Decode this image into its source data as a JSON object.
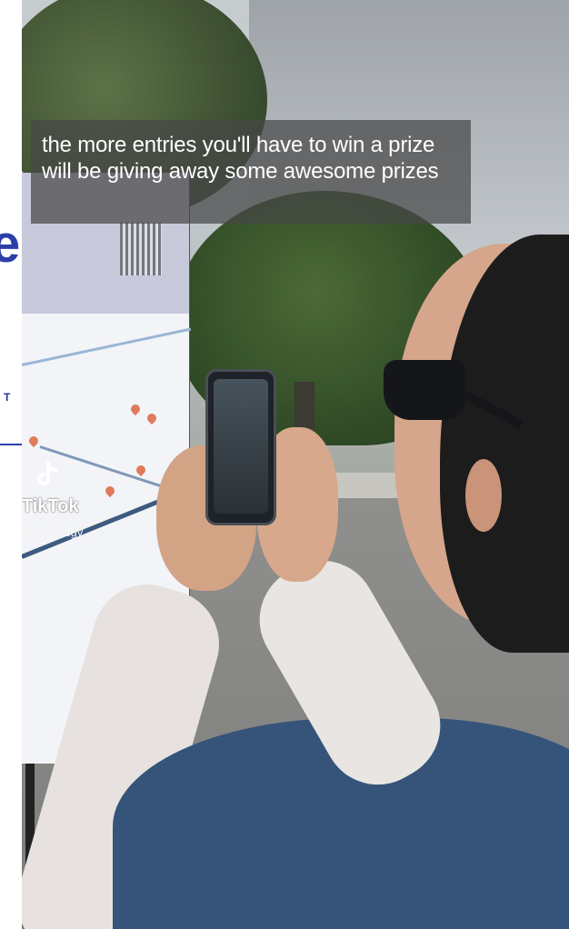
{
  "page_edge": {
    "letter": "e",
    "text_fragment": "T"
  },
  "video": {
    "caption": "the more entries you'll have to win a prize will be giving away some awesome prizes",
    "watermark": {
      "app_name": "TikTok",
      "handle": "@activesgv",
      "logo_icon": "tiktok-logo-icon"
    }
  }
}
